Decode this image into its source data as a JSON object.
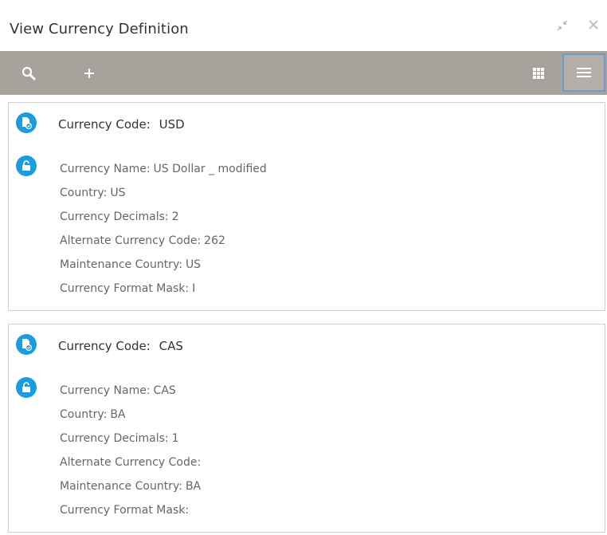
{
  "window": {
    "title": "View Currency Definition",
    "minimize_glyph": "↙↗",
    "close_glyph": "×"
  },
  "toolbar": {
    "icons": [
      "search-icon",
      "add-icon",
      "grid-view-icon",
      "list-view-icon"
    ],
    "active_view": "list",
    "accent_color": "#1c9ce0",
    "bar_color": "#a7a29c"
  },
  "labels": {
    "currency_code": "Currency Code:",
    "currency_name": "Currency Name:",
    "country": "Country:",
    "currency_decimals": "Currency Decimals:",
    "alternate_currency_code": "Alternate Currency Code:",
    "maintenance_country": "Maintenance Country:",
    "currency_format_mask": "Currency Format Mask:"
  },
  "records": [
    {
      "currency_code": "USD",
      "currency_name": "US Dollar _ modified",
      "country": "US",
      "currency_decimals": "2",
      "alternate_currency_code": "262",
      "maintenance_country": "US",
      "currency_format_mask": "I"
    },
    {
      "currency_code": "CAS",
      "currency_name": "CAS",
      "country": "BA",
      "currency_decimals": "1",
      "alternate_currency_code": "",
      "maintenance_country": "BA",
      "currency_format_mask": ""
    }
  ]
}
